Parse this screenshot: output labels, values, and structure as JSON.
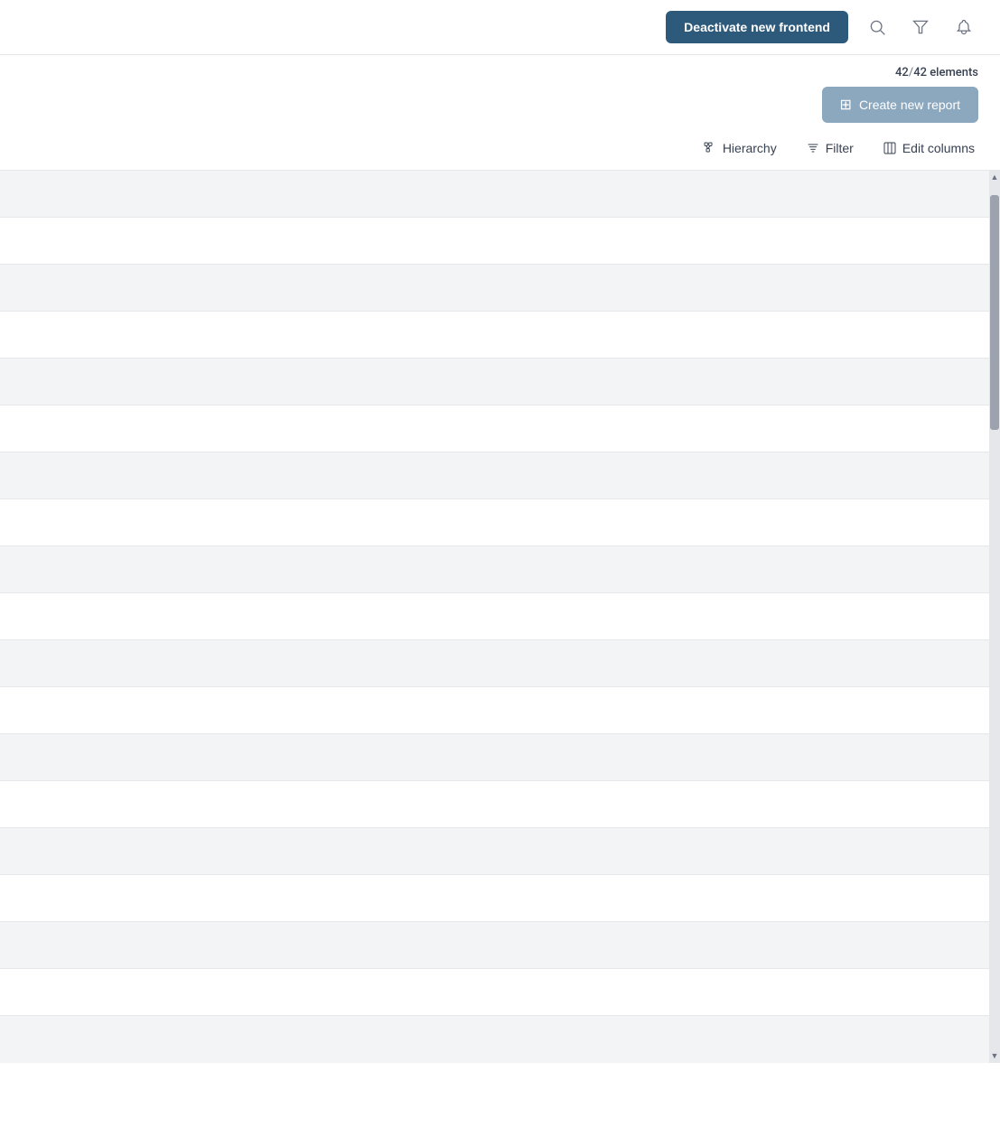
{
  "topbar": {
    "deactivate_label": "Deactivate new frontend",
    "search_icon": "search",
    "filter_icon": "filter",
    "bell_icon": "bell"
  },
  "toolbar": {
    "elements_current": "42",
    "elements_total": "42",
    "elements_label": "elements",
    "create_report_label": "Create new report"
  },
  "filter_bar": {
    "hierarchy_label": "Hierarchy",
    "filter_label": "Filter",
    "edit_columns_label": "Edit columns"
  },
  "table": {
    "row_count": 18
  }
}
